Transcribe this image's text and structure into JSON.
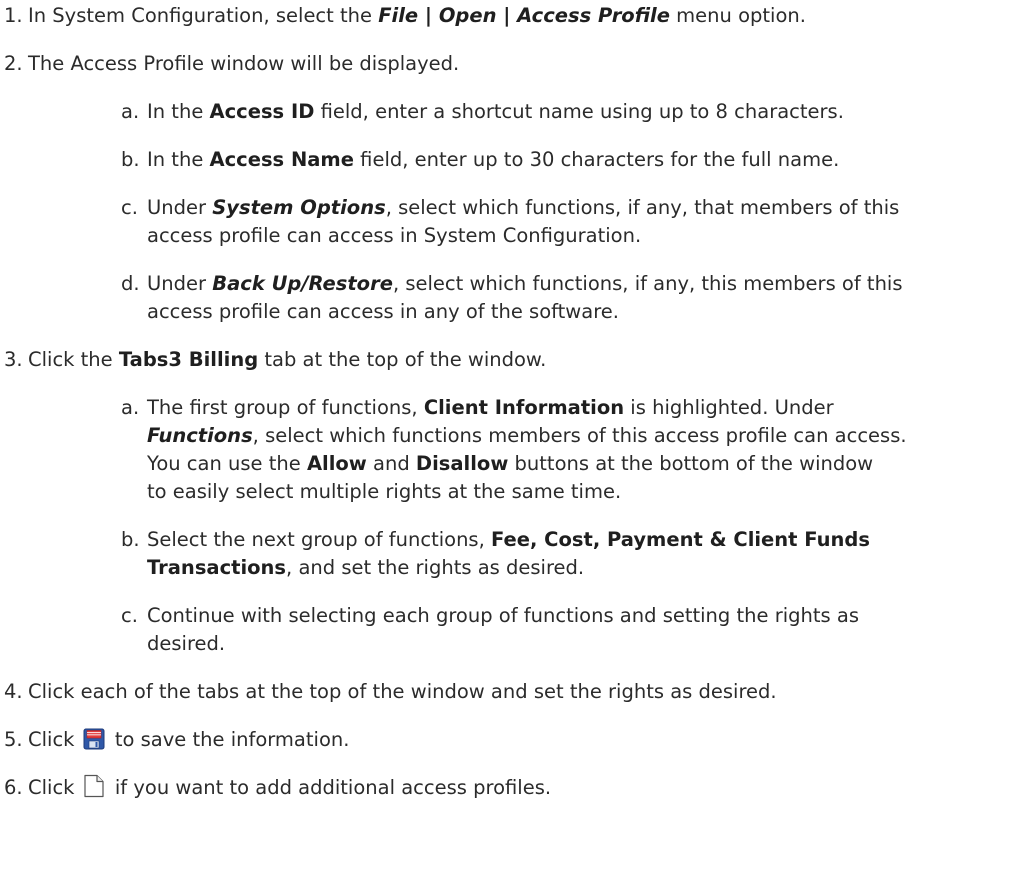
{
  "steps": [
    {
      "number": "1.",
      "parts": {
        "a": "In System Configuration, select the ",
        "b": "File | Open | Access Profile",
        "c": " menu option."
      }
    },
    {
      "number": "2.",
      "text": "The Access Profile window will be displayed.",
      "substeps": [
        {
          "letter": "a.",
          "parts": {
            "a": "In the ",
            "b": "Access ID",
            "c": " field, enter a shortcut name using up to 8 characters."
          }
        },
        {
          "letter": "b.",
          "parts": {
            "a": "In the ",
            "b": "Access Name",
            "c": " field, enter up to 30 characters for the full name."
          }
        },
        {
          "letter": "c.",
          "parts": {
            "a": "Under ",
            "b": "System Options",
            "c": ", select which functions, if any, that members of this",
            "d": "access profile can access in System Configuration."
          }
        },
        {
          "letter": "d.",
          "parts": {
            "a": "Under ",
            "b": "Back Up/Restore",
            "c": ", select which functions, if any, this members of this",
            "d": "access profile can access in any of the software."
          }
        }
      ]
    },
    {
      "number": "3.",
      "parts": {
        "a": "Click the ",
        "b": "Tabs3 Billing",
        "c": " tab at the top of the window."
      },
      "substeps": [
        {
          "letter": "a.",
          "parts": {
            "a": "The first group of functions, ",
            "b": "Client Information",
            "c": " is highlighted. Under",
            "d": "Functions",
            "e": ", select which functions members of this access profile can access.",
            "f": "You can use the ",
            "g": "Allow",
            "h": " and ",
            "i": "Disallow",
            "j": " buttons at the bottom of the window",
            "k": "to easily select multiple rights at the same time."
          }
        },
        {
          "letter": "b.",
          "parts": {
            "a": "Select the next group of functions, ",
            "b": "Fee, Cost, Payment & Client Funds",
            "c": "Transactions",
            "d": ", and set the rights as desired."
          }
        },
        {
          "letter": "c.",
          "parts": {
            "a": "Continue with selecting each group of functions and setting the rights as",
            "b": "desired."
          }
        }
      ]
    },
    {
      "number": "4.",
      "text": "Click each of the tabs at the top of the window and set the rights as desired."
    },
    {
      "number": "5.",
      "parts": {
        "a": "Click ",
        "c": " to save the information."
      },
      "icon": "save-floppy-icon"
    },
    {
      "number": "6.",
      "parts": {
        "a": "Click ",
        "c": " if you want to add additional access profiles."
      },
      "icon": "new-document-icon"
    }
  ]
}
